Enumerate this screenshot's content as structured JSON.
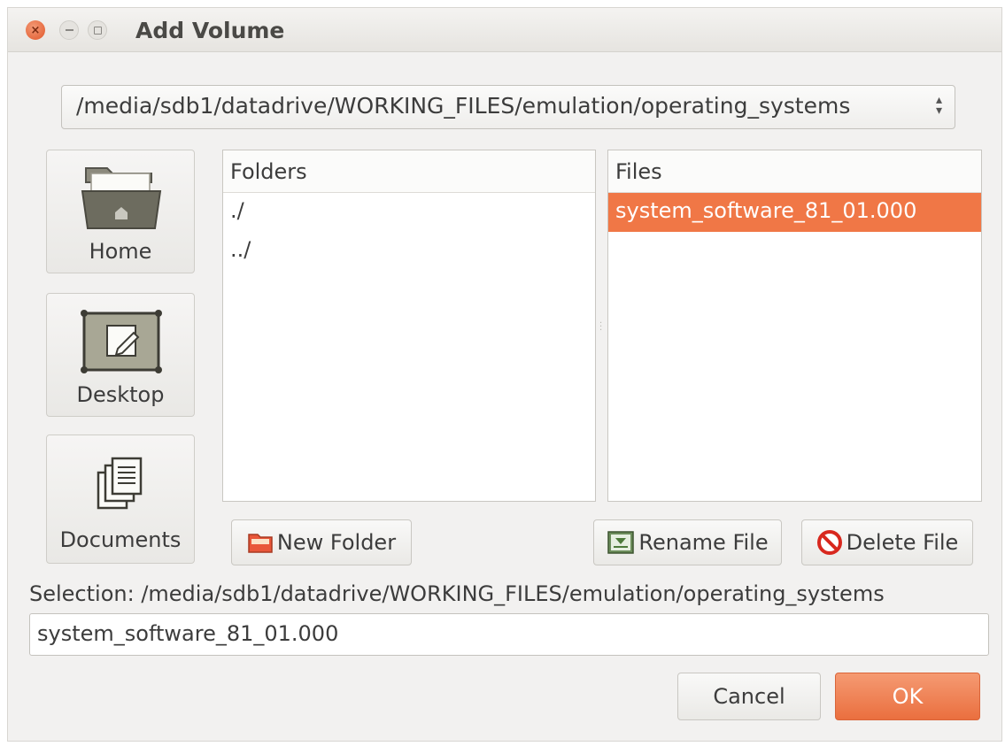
{
  "window": {
    "title": "Add Volume"
  },
  "path": {
    "current": "/media/sdb1/datadrive/WORKING_FILES/emulation/operating_systems"
  },
  "sidebar": {
    "items": [
      {
        "label": "Home",
        "icon": "home-folder-icon"
      },
      {
        "label": "Desktop",
        "icon": "desktop-icon"
      },
      {
        "label": "Documents",
        "icon": "documents-icon"
      }
    ]
  },
  "folders": {
    "header": "Folders",
    "items": [
      "./",
      "../"
    ]
  },
  "files": {
    "header": "Files",
    "items": [
      "system_software_81_01.000"
    ],
    "selected_index": 0
  },
  "buttons": {
    "new_folder": "New Folder",
    "rename_file": "Rename File",
    "delete_file": "Delete File",
    "cancel": "Cancel",
    "ok": "OK"
  },
  "selection": {
    "label": "Selection: /media/sdb1/datadrive/WORKING_FILES/emulation/operating_systems",
    "value": "system_software_81_01.000"
  },
  "colors": {
    "accent": "#f07746"
  }
}
